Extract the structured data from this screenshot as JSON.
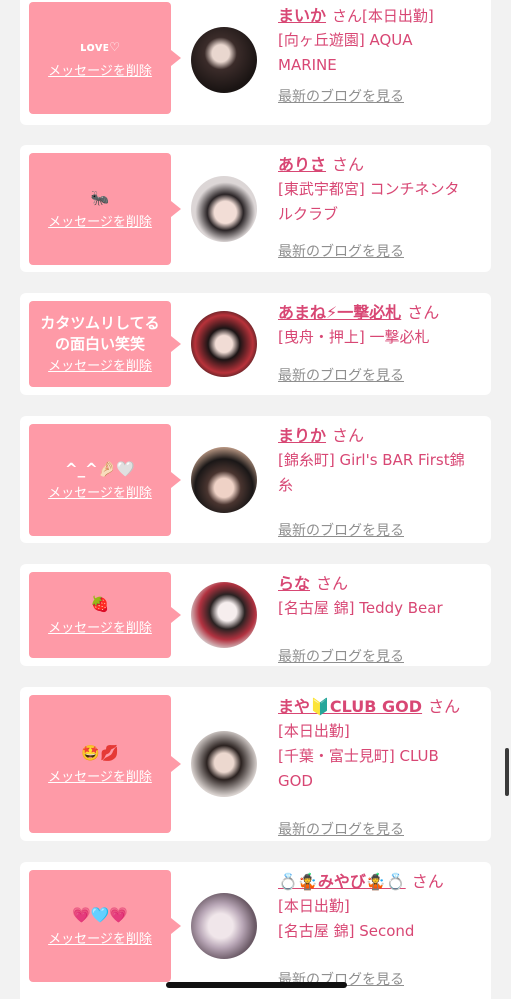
{
  "delete_label": "メッセージを削除",
  "blog_label": "最新のブログを見る",
  "san_label": "さん",
  "cards": [
    {
      "message": "ʟᴏᴠᴇ♡",
      "name": "まいか",
      "inline_tag": "[本日出勤]",
      "lines": [
        "[向ヶ丘遊園] AQUA",
        "MARINE"
      ]
    },
    {
      "message": "🐜",
      "name": "ありさ",
      "lines": [
        "[東武宇都宮] コンチネンタ",
        "ルクラブ"
      ]
    },
    {
      "message_lines": [
        "カタツムリしてる",
        "の面白い笑笑"
      ],
      "name": "あまね⚡一撃必札",
      "lines": [
        "[曳舟・押上] 一撃必札"
      ]
    },
    {
      "message": "^_^🤌🏻🤍",
      "name": "まりか",
      "lines": [
        "[錦糸町] Girl's BAR First錦",
        "糸"
      ]
    },
    {
      "message": "🍓",
      "name": "らな",
      "lines": [
        "[名古屋 錦] Teddy Bear"
      ]
    },
    {
      "message": "🤩💋",
      "name": "まや🔰CLUB GOD",
      "lines": [
        "[本日出勤]",
        "[千葉・富士見町] CLUB",
        "GOD"
      ]
    },
    {
      "message": "💗🩵💗",
      "name": "💍🤹みやび🤹💍",
      "lines": [
        "[本日出勤]",
        "[名古屋 錦] Second"
      ]
    }
  ],
  "colors": {
    "bubble": "#fe9aa7",
    "accent": "#d84774",
    "link_gray": "#8f8f8f",
    "background": "#f2f2f2"
  }
}
